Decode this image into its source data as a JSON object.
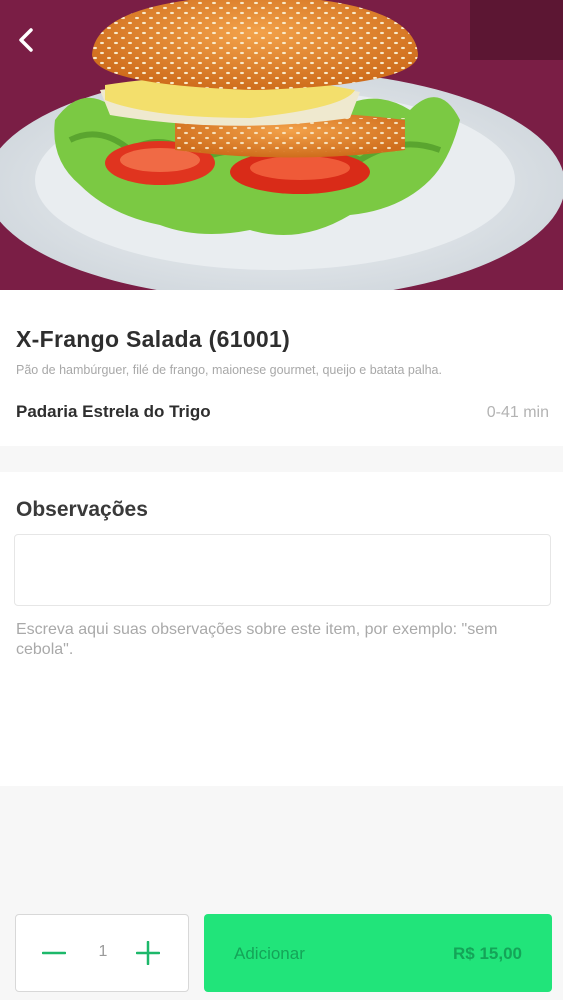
{
  "header": {
    "back_icon": "chevron-left-icon"
  },
  "product": {
    "title": "X-Frango Salada (61001)",
    "description": "Pão de hambúrguer, filé de frango, maionese gourmet, queijo e batata palha.",
    "store": "Padaria Estrela do Trigo",
    "eta": "0-41 min"
  },
  "observations": {
    "title": "Observações",
    "input_value": "",
    "help": "Escreva aqui suas observações sobre este item, por exemplo: \"sem cebola\"."
  },
  "cart": {
    "quantity": "1",
    "minus_icon": "minus-icon",
    "plus_icon": "plus-icon",
    "add_label": "Adicionar",
    "price": "R$ 15,00"
  },
  "colors": {
    "accent": "#21e47a",
    "accent_text": "#14a458",
    "icon_green": "#1db86a",
    "hero_background": "#7a1e45"
  }
}
